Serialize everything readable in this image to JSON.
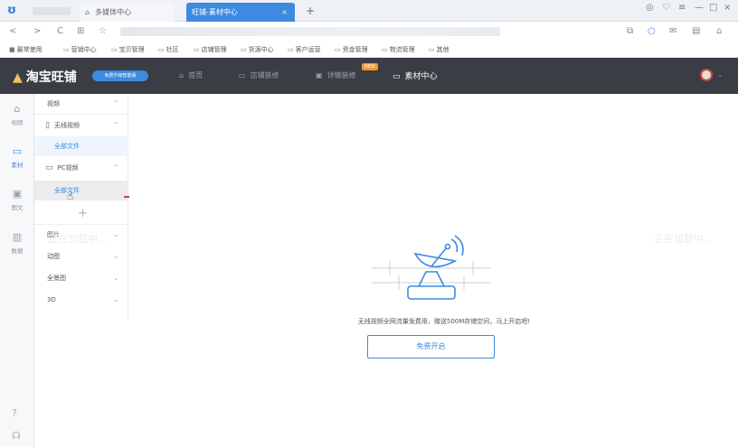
{
  "browser": {
    "home_tab_label": "多媒体中心",
    "active_tab_label": "旺铺-素材中心",
    "active_tab_close": "×",
    "new_tab": "+",
    "window_controls": [
      "◎",
      "♡",
      "≡",
      "—",
      "□",
      "×"
    ],
    "nav_back": "<",
    "nav_forward": ">",
    "nav_reload": "C",
    "nav_grid": "⊞",
    "nav_star": "☆"
  },
  "bookmarks": [
    "最常使用",
    "营销中心",
    "宝贝管理",
    "社区",
    "店铺管理",
    "货源中心",
    "客户运营",
    "资金管理",
    "物流管理",
    "其他"
  ],
  "header": {
    "brand": "淘宝旺铺",
    "upgrade_badge": "免费升级智能版",
    "nav": [
      {
        "label": "首页",
        "icon": "home-icon"
      },
      {
        "label": "店铺装修",
        "icon": "monitor-icon"
      },
      {
        "label": "详情装修",
        "icon": "detail-icon"
      },
      {
        "label": "素材中心",
        "icon": "folder-icon"
      }
    ],
    "new_badge": "NEW"
  },
  "rail": [
    {
      "label": "视频",
      "icon": "video-icon"
    },
    {
      "label": "素材",
      "icon": "folder-icon"
    },
    {
      "label": "图文",
      "icon": "image-text-icon"
    },
    {
      "label": "数据",
      "icon": "chart-icon"
    }
  ],
  "tree": {
    "video_header": "视频",
    "wireless_video": "无线视频",
    "wireless_all_files": "全部文件",
    "pc_video": "PC视频",
    "pc_all_files": "全部文件",
    "add": "+",
    "categories": [
      "图片",
      "动图",
      "全景图",
      "3D"
    ]
  },
  "callout": "单击",
  "main": {
    "loading_text": "正在加载中...",
    "empty_text": "无线视频全网流量免费用，赠送500M存储空间，马上开启吧!",
    "free_button": "免费开启"
  },
  "colors": {
    "accent": "#3d8ae0",
    "header_bg": "#3a3d44",
    "callout_red": "#d23a3a"
  }
}
